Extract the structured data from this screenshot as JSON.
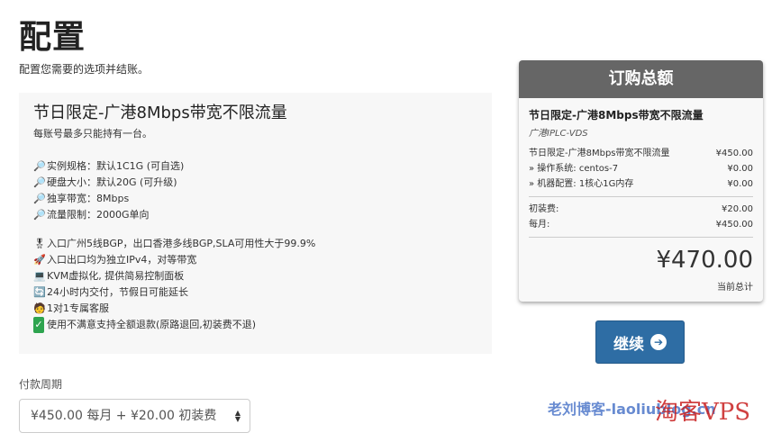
{
  "page": {
    "title": "配置",
    "subtitle": "配置您需要的选项并结账。"
  },
  "product": {
    "name": "节日限定-广港8Mbps带宽不限流量",
    "limit": "每账号最多只能持有一台。",
    "specs": [
      {
        "icon": "magnifier-icon",
        "text": "实例规格：默认1C1G (可自选)"
      },
      {
        "icon": "magnifier-icon",
        "text": "硬盘大小：默认20G (可升级)"
      },
      {
        "icon": "magnifier-icon",
        "text": "独享带宽：8Mbps"
      },
      {
        "icon": "magnifier-icon",
        "text": "流量限制：2000G单向"
      }
    ],
    "features": [
      {
        "icon": "medal-icon",
        "text": "入口广州5线BGP，出口香港多线BGP,SLA可用性大于99.9%"
      },
      {
        "icon": "rocket-icon",
        "text": "入口出口均为独立IPv4，对等带宽"
      },
      {
        "icon": "laptop-icon",
        "text": "KVM虚拟化, 提供简易控制面板"
      },
      {
        "icon": "refresh-icon",
        "text": "24小时内交付，节假日可能延长"
      },
      {
        "icon": "support-person-icon",
        "text": "1对1专属客服"
      },
      {
        "icon": "checkmark-icon",
        "text": "使用不满意支持全额退款(原路退回,初装费不退)"
      }
    ]
  },
  "billing": {
    "label": "付款周期",
    "selected": "¥450.00 每月 + ¥20.00 初装费"
  },
  "summary": {
    "header": "订购总额",
    "product_name": "节日限定-广港8Mbps带宽不限流量",
    "group": "广港IPLC-VDS",
    "lines": [
      {
        "label": "节日限定-广港8Mbps带宽不限流量",
        "amount": "¥450.00"
      },
      {
        "label": "» 操作系统: centos-7",
        "amount": "¥0.00"
      },
      {
        "label": "» 机器配置: 1核心1G内存",
        "amount": "¥0.00"
      }
    ],
    "setup_fee_label": "初装费:",
    "setup_fee": "¥20.00",
    "monthly_label": "每月:",
    "monthly": "¥450.00",
    "total": "¥470.00",
    "total_label": "当前总计"
  },
  "continue": {
    "label": "继续",
    "icon": "arrow-right-circle-icon"
  },
  "watermark": {
    "left": "老刘博客-laoliublog.cn",
    "right": "淘客VPS"
  },
  "colors": {
    "accent": "#2e6da4",
    "summary_header": "#666666"
  }
}
